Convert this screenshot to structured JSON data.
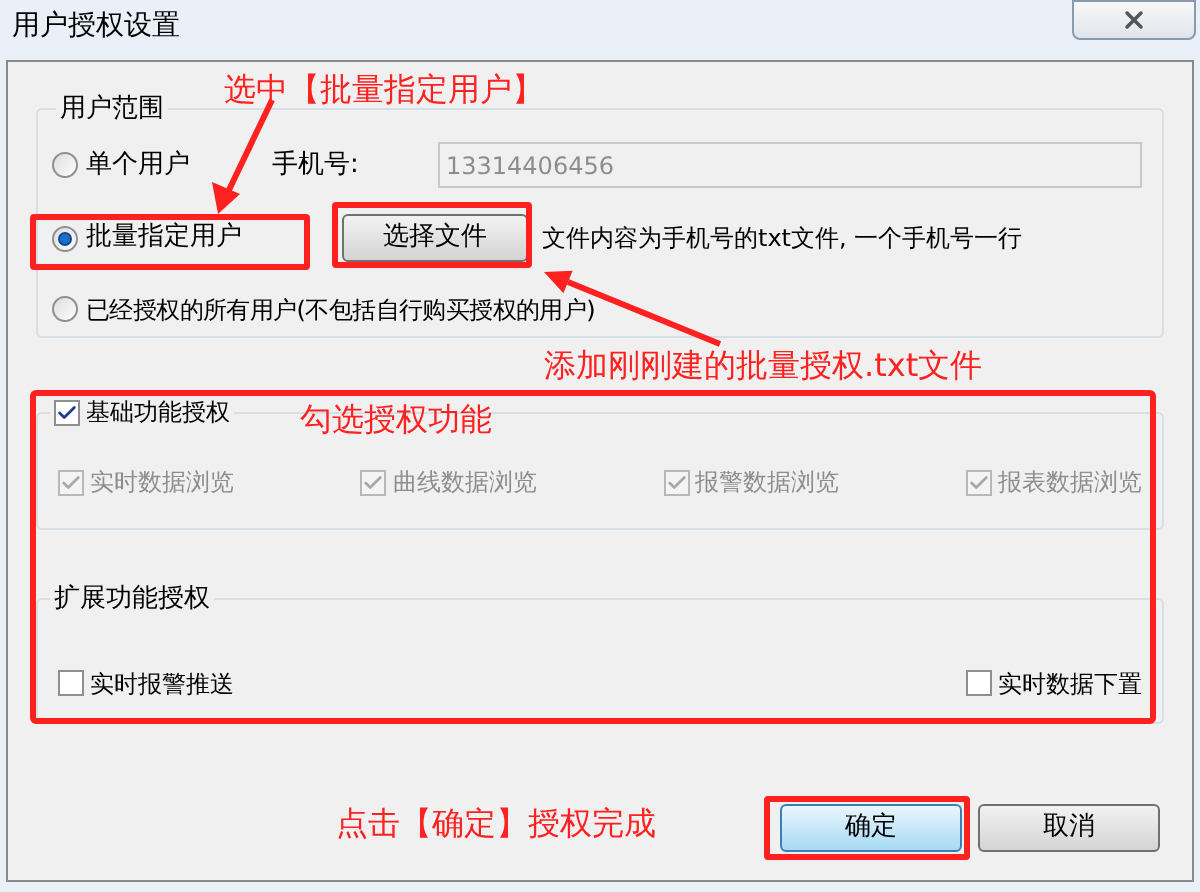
{
  "window": {
    "title": "用户授权设置"
  },
  "user_scope": {
    "title": "用户范围",
    "options": [
      {
        "label": "单个用户",
        "selected": false
      },
      {
        "label": "批量指定用户",
        "selected": true
      },
      {
        "label": "已经授权的所有用户(不包括自行购买授权的用户)",
        "selected": false
      }
    ],
    "phone": {
      "label": "手机号:",
      "value": "13314406456",
      "disabled": true
    },
    "file_button": "选择文件",
    "file_hint": "文件内容为手机号的txt文件, 一个手机号一行"
  },
  "basic": {
    "label": "基础功能授权",
    "checked": true,
    "items": [
      {
        "label": "实时数据浏览",
        "checked": true,
        "disabled": true
      },
      {
        "label": "曲线数据浏览",
        "checked": true,
        "disabled": true
      },
      {
        "label": "报警数据浏览",
        "checked": true,
        "disabled": true
      },
      {
        "label": "报表数据浏览",
        "checked": true,
        "disabled": true
      }
    ]
  },
  "extended": {
    "title": "扩展功能授权",
    "items": [
      {
        "label": "实时报警推送",
        "checked": false,
        "disabled": false
      },
      {
        "label": "实时数据下置",
        "checked": false,
        "disabled": false
      }
    ]
  },
  "buttons": [
    {
      "label": "确定",
      "kind": "primary"
    },
    {
      "label": "取消",
      "kind": "normal"
    }
  ],
  "annotations": [
    {
      "text": "选中【批量指定用户】"
    },
    {
      "text": "添加刚刚建的批量授权.txt文件"
    },
    {
      "text": "勾选授权功能"
    },
    {
      "text": "点击【确定】授权完成"
    }
  ]
}
